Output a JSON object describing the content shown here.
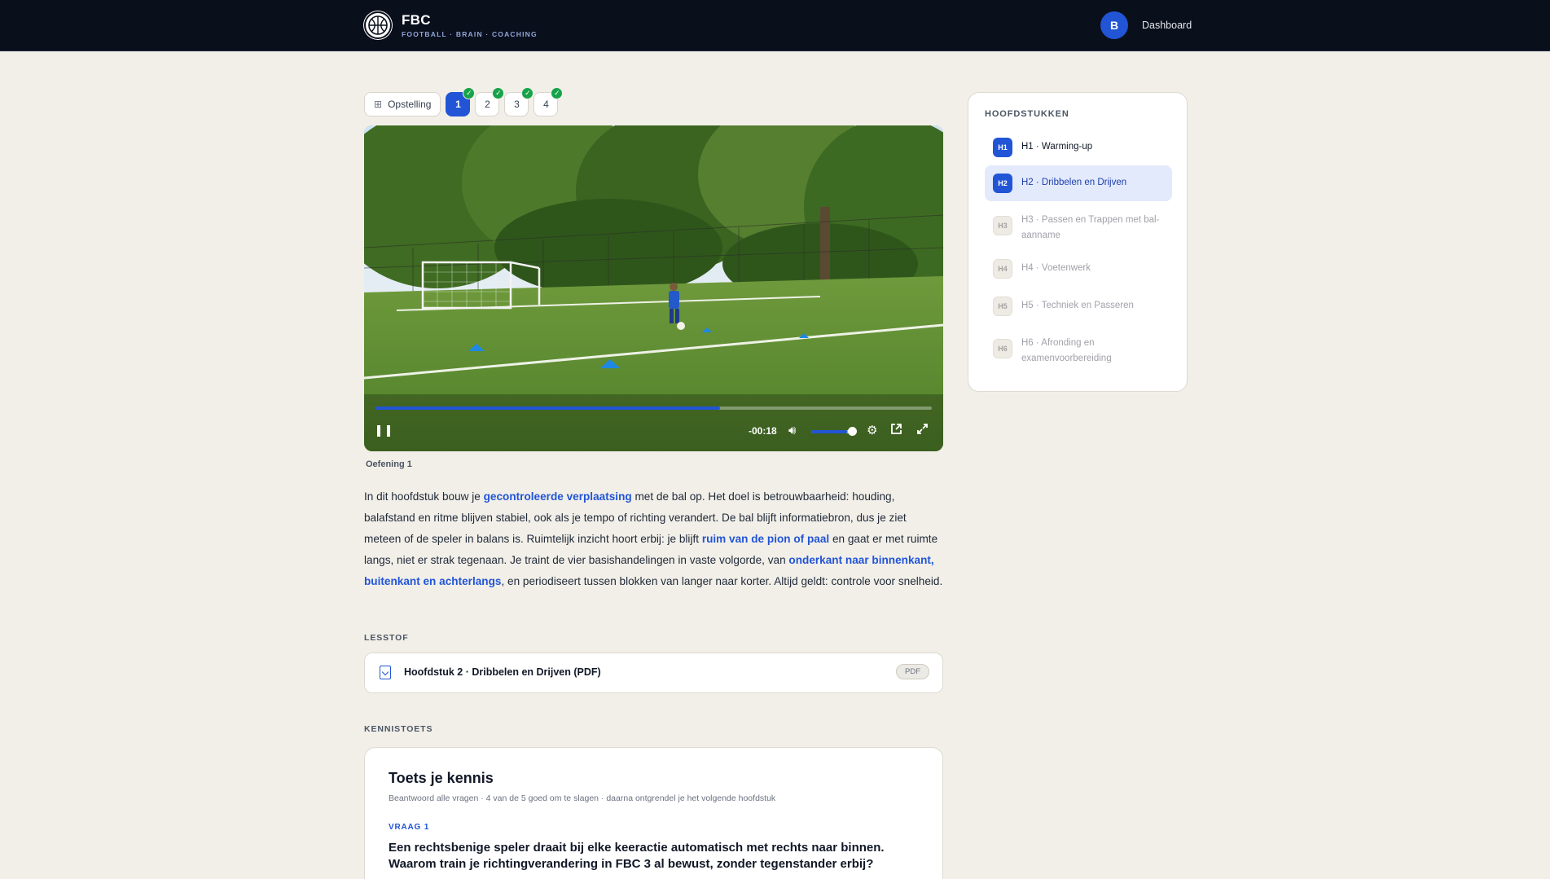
{
  "header": {
    "brand_title": "FBC",
    "brand_subtitle": "FOOTBALL · BRAIN · COACHING",
    "user_initial": "B",
    "dashboard_link": "Dashboard"
  },
  "steps": {
    "setup_label": "Opstelling",
    "items": [
      {
        "label": "1",
        "active": true,
        "completed": true
      },
      {
        "label": "2",
        "active": false,
        "completed": true
      },
      {
        "label": "3",
        "active": false,
        "completed": true
      },
      {
        "label": "4",
        "active": false,
        "completed": true
      }
    ]
  },
  "video": {
    "time_remaining": "-00:18",
    "progress": 0.62,
    "volume": 0.85,
    "caption": "Oefening 1"
  },
  "intro": {
    "p1": "In dit hoofdstuk bouw je ",
    "link1": "gecontroleerde verplaatsing",
    "p2": " met de bal op. Het doel is betrouwbaarheid: houding, balafstand en ritme blijven stabiel, ook als je tempo of richting verandert. De bal blijft informatiebron, dus je ziet meteen of de speler in balans is. Ruimtelijk inzicht hoort erbij: je blijft ",
    "link2": "ruim van de pion of paal",
    "p3": " en gaat er met ruimte langs, niet er strak tegenaan. Je traint de vier basishandelingen in vaste volgorde, van ",
    "link3": "onderkant naar binnenkant, buitenkant en achterlangs",
    "p4": ", en periodiseert tussen blokken van langer naar korter. Altijd geldt: controle voor snelheid."
  },
  "lesstof": {
    "section_label": "LESSTOF",
    "file_title": "Hoofdstuk 2 · Dribbelen en Drijven (PDF)",
    "file_badge": "PDF"
  },
  "quiz": {
    "section_label": "KENNISTOETS",
    "title": "Toets je kennis",
    "subtitle": "Beantwoord alle vragen · 4 van de 5 goed om te slagen · daarna ontgrendel je het volgende hoofdstuk",
    "question_label": "VRAAG 1",
    "question_text": "Een rechtsbenige speler draait bij elke keeractie automatisch met rechts naar binnen. Waarom train je richtingverandering in FBC 3 al bewust, zonder tegenstander erbij?"
  },
  "chapters": {
    "heading": "HOOFDSTUKKEN",
    "items": [
      {
        "badge": "H1",
        "label": "H1 · Warming-up",
        "state": "done"
      },
      {
        "badge": "H2",
        "label": "H2 · Dribbelen en Drijven",
        "state": "current"
      },
      {
        "badge": "H3",
        "label": "H3 · Passen en Trappen met bal-aanname",
        "state": "locked"
      },
      {
        "badge": "H4",
        "label": "H4 · Voetenwerk",
        "state": "locked"
      },
      {
        "badge": "H5",
        "label": "H5 · Techniek en Passeren",
        "state": "locked"
      },
      {
        "badge": "H6",
        "label": "H6 · Afronding en examenvoorbereiding",
        "state": "locked"
      }
    ]
  },
  "colors": {
    "accent": "#2155d6",
    "header_bg": "#0a0f1c",
    "page_bg": "#f2efe9",
    "success": "#16a34a"
  }
}
